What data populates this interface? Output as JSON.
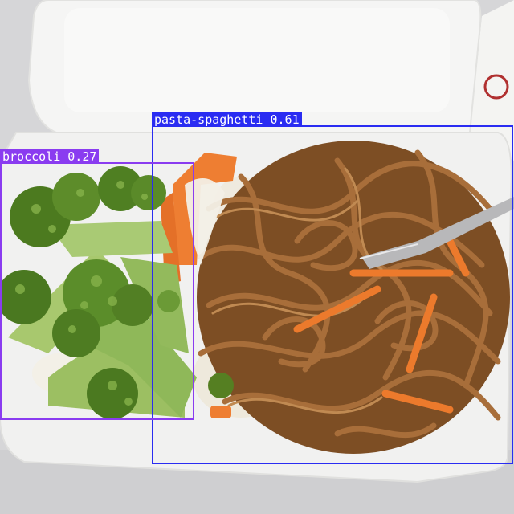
{
  "detections": [
    {
      "label": "pasta-spaghetti 0.61",
      "class": "pasta-spaghetti",
      "confidence": 0.61,
      "color": "#2a2cf2"
    },
    {
      "label": "broccoli 0.27",
      "class": "broccoli",
      "confidence": 0.27,
      "color": "#8a3cf0"
    }
  ],
  "scene": {
    "colors": {
      "table": "#d9d9db",
      "container": "#f3f3f2",
      "noodles": "#8a5a2c",
      "broccoli": "#5d8f2a",
      "carrot": "#e8742a"
    }
  }
}
